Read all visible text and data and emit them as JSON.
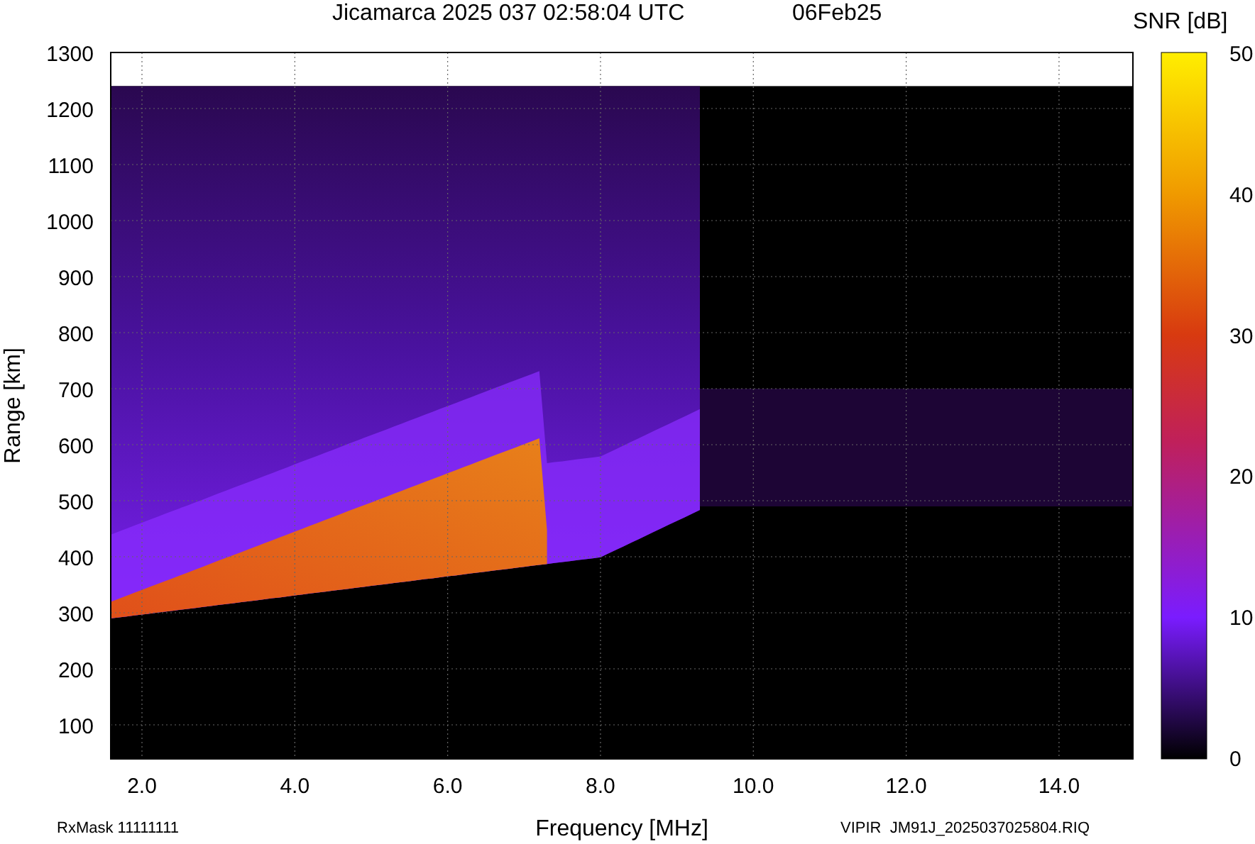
{
  "title": "Jicamarca 2025 037 02:58:04 UTC",
  "date": "06Feb25",
  "y_axis": {
    "label": "Range [km]",
    "ticks": [
      "1300",
      "1200",
      "1100",
      "1000",
      "900",
      "800",
      "700",
      "600",
      "500",
      "400",
      "300",
      "200",
      "100"
    ]
  },
  "x_axis": {
    "label": "Frequency [MHz]",
    "ticks": [
      "2.0",
      "4.0",
      "6.0",
      "8.0",
      "10.0",
      "12.0",
      "14.0"
    ]
  },
  "colorbar": {
    "label": "SNR [dB]",
    "ticks": [
      "50",
      "40",
      "30",
      "20",
      "10",
      "0"
    ]
  },
  "footer_left": "RxMask 11111111",
  "footer_right": "VIPIR  JM91J_2025037025804.RIQ"
}
